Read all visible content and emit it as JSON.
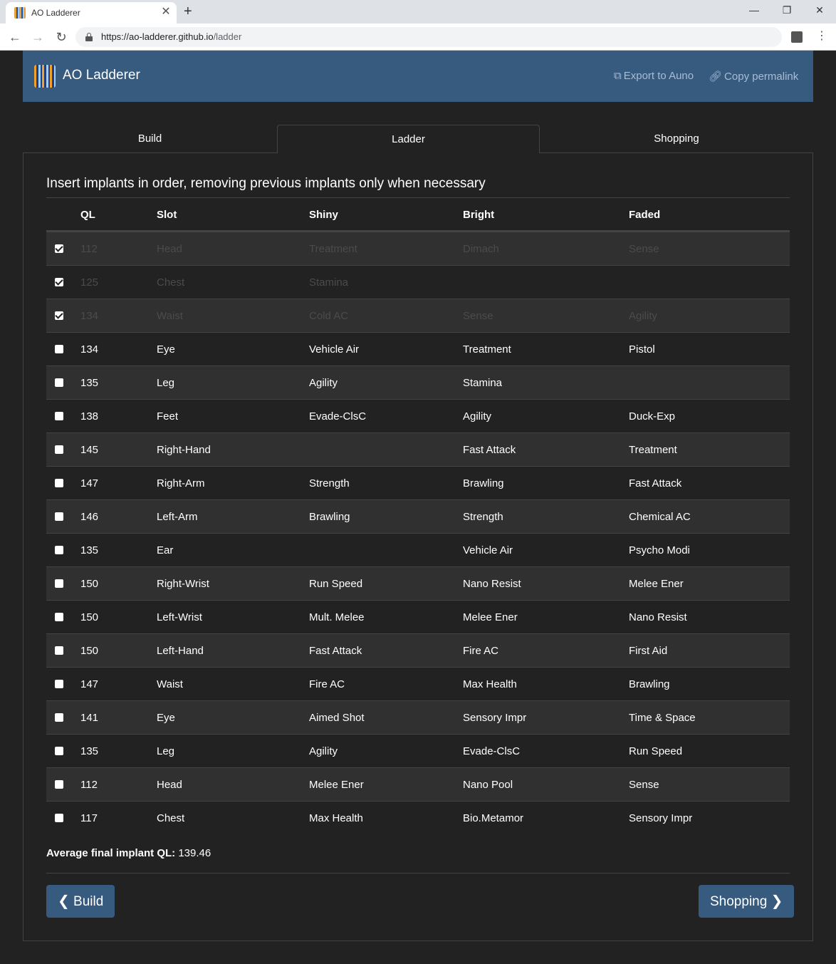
{
  "browser": {
    "tab_title": "AO Ladderer",
    "url_host": "https://ao-ladderer.github.io",
    "url_path": "/ladder"
  },
  "navbar": {
    "brand": "AO Ladderer",
    "export_label": "Export to Auno",
    "permalink_label": "Copy permalink"
  },
  "tabs": [
    "Build",
    "Ladder",
    "Shopping"
  ],
  "heading": "Insert implants in order, removing previous implants only when necessary",
  "columns": [
    "QL",
    "Slot",
    "Shiny",
    "Bright",
    "Faded"
  ],
  "rows": [
    {
      "done": true,
      "ql": "112",
      "slot": "Head",
      "shiny": "Treatment",
      "bright": "Dimach",
      "faded": "Sense"
    },
    {
      "done": true,
      "ql": "125",
      "slot": "Chest",
      "shiny": "Stamina",
      "bright": "",
      "faded": ""
    },
    {
      "done": true,
      "ql": "134",
      "slot": "Waist",
      "shiny": "Cold AC",
      "bright": "Sense",
      "faded": "Agility"
    },
    {
      "done": false,
      "ql": "134",
      "slot": "Eye",
      "shiny": "Vehicle Air",
      "bright": "Treatment",
      "faded": "Pistol"
    },
    {
      "done": false,
      "ql": "135",
      "slot": "Leg",
      "shiny": "Agility",
      "bright": "Stamina",
      "faded": ""
    },
    {
      "done": false,
      "ql": "138",
      "slot": "Feet",
      "shiny": "Evade-ClsC",
      "bright": "Agility",
      "faded": "Duck-Exp"
    },
    {
      "done": false,
      "ql": "145",
      "slot": "Right-Hand",
      "shiny": "",
      "bright": "Fast Attack",
      "faded": "Treatment"
    },
    {
      "done": false,
      "ql": "147",
      "slot": "Right-Arm",
      "shiny": "Strength",
      "bright": "Brawling",
      "faded": "Fast Attack"
    },
    {
      "done": false,
      "ql": "146",
      "slot": "Left-Arm",
      "shiny": "Brawling",
      "bright": "Strength",
      "faded": "Chemical AC"
    },
    {
      "done": false,
      "ql": "135",
      "slot": "Ear",
      "shiny": "",
      "bright": "Vehicle Air",
      "faded": "Psycho Modi"
    },
    {
      "done": false,
      "ql": "150",
      "slot": "Right-Wrist",
      "shiny": "Run Speed",
      "bright": "Nano Resist",
      "faded": "Melee Ener"
    },
    {
      "done": false,
      "ql": "150",
      "slot": "Left-Wrist",
      "shiny": "Mult. Melee",
      "bright": "Melee Ener",
      "faded": "Nano Resist"
    },
    {
      "done": false,
      "ql": "150",
      "slot": "Left-Hand",
      "shiny": "Fast Attack",
      "bright": "Fire AC",
      "faded": "First Aid"
    },
    {
      "done": false,
      "ql": "147",
      "slot": "Waist",
      "shiny": "Fire AC",
      "bright": "Max Health",
      "faded": "Brawling"
    },
    {
      "done": false,
      "ql": "141",
      "slot": "Eye",
      "shiny": "Aimed Shot",
      "bright": "Sensory Impr",
      "faded": "Time & Space"
    },
    {
      "done": false,
      "ql": "135",
      "slot": "Leg",
      "shiny": "Agility",
      "bright": "Evade-ClsC",
      "faded": "Run Speed"
    },
    {
      "done": false,
      "ql": "112",
      "slot": "Head",
      "shiny": "Melee Ener",
      "bright": "Nano Pool",
      "faded": "Sense"
    },
    {
      "done": false,
      "ql": "117",
      "slot": "Chest",
      "shiny": "Max Health",
      "bright": "Bio.Metamor",
      "faded": "Sensory Impr"
    }
  ],
  "summary": {
    "label": "Average final implant QL:",
    "value": "139.46"
  },
  "footer": {
    "back_label": "Build",
    "next_label": "Shopping"
  },
  "colors": {
    "background": "#222222",
    "accent": "#375a7f",
    "row_stripe": "#303030"
  }
}
